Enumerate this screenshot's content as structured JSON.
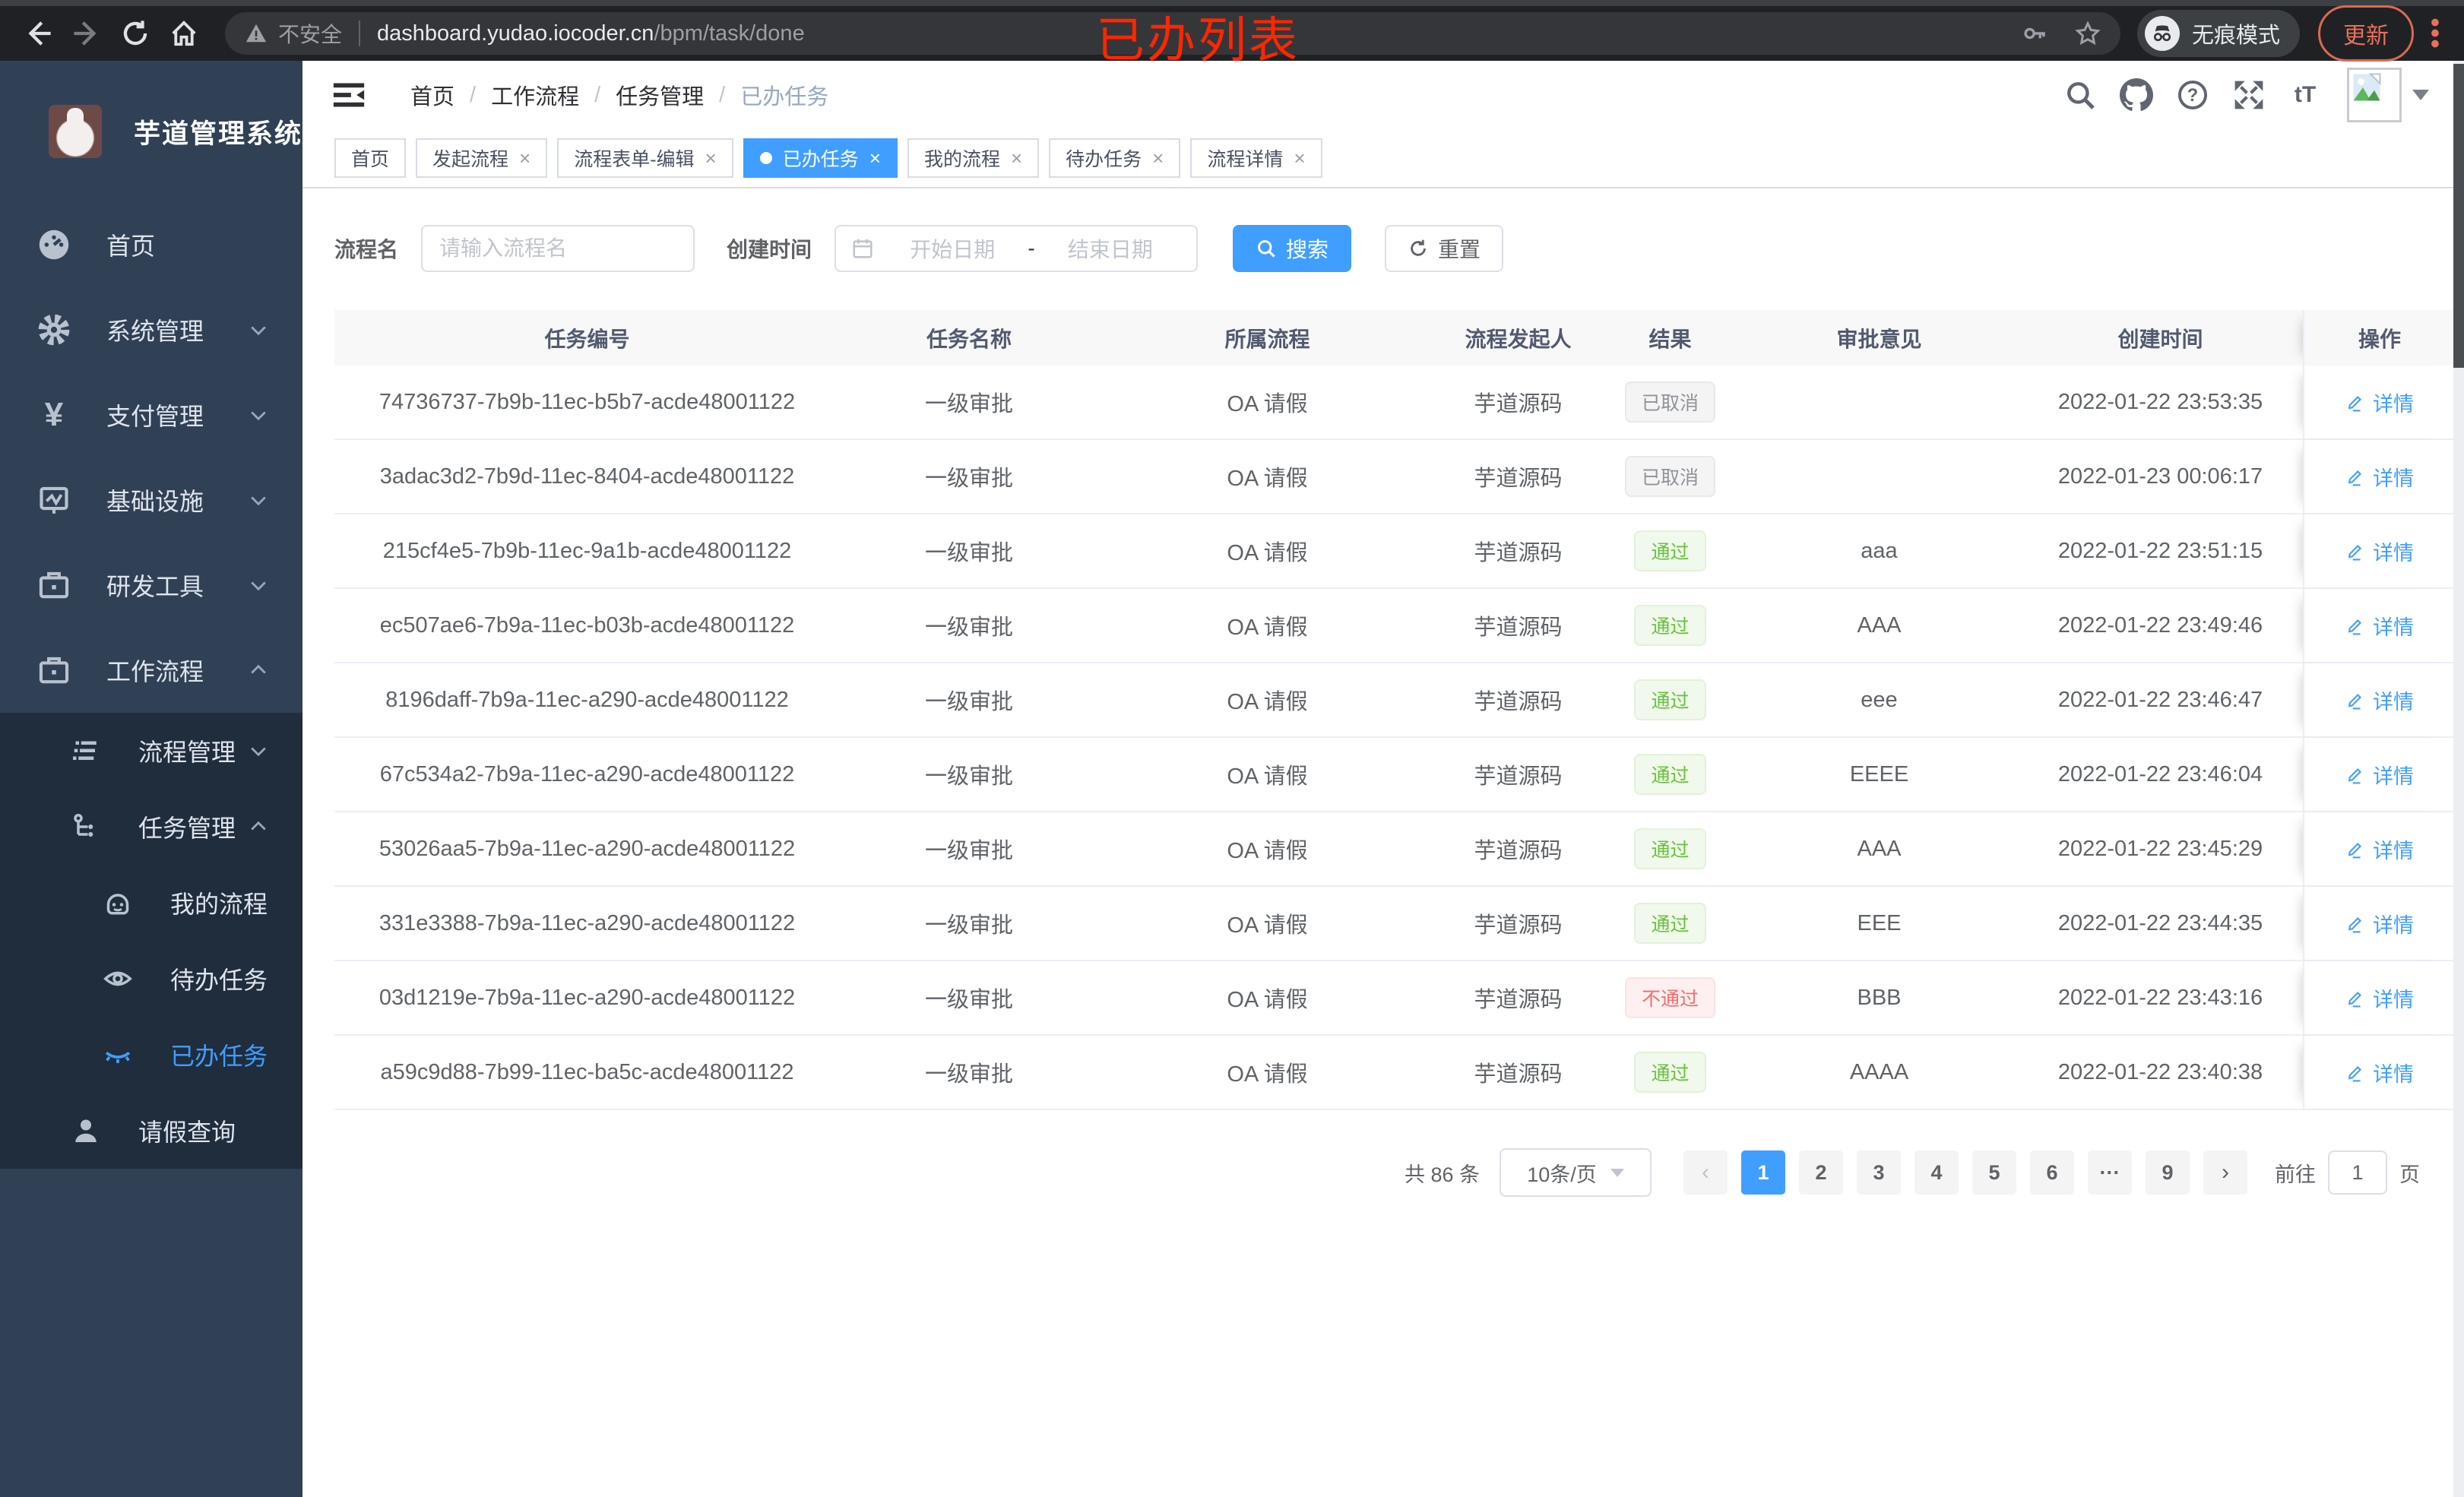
{
  "browser": {
    "not_secure": "不安全",
    "url_host": "dashboard.yudao.iocoder.cn",
    "url_path": "/bpm/task/done",
    "incognito": "无痕模式",
    "update": "更新"
  },
  "annotation": {
    "text": "已办列表",
    "color": "#ff2600"
  },
  "sidebar": {
    "title": "芋道管理系统",
    "menu": [
      {
        "label": "首页",
        "icon": "dashboard-icon"
      },
      {
        "label": "系统管理",
        "icon": "gear-icon"
      },
      {
        "label": "支付管理",
        "icon": "yen-icon"
      },
      {
        "label": "基础设施",
        "icon": "monitor-icon"
      },
      {
        "label": "研发工具",
        "icon": "briefcase-icon"
      },
      {
        "label": "工作流程",
        "icon": "briefcase-icon"
      }
    ],
    "submenu": [
      {
        "label": "流程管理",
        "icon": "list-icon"
      },
      {
        "label": "任务管理",
        "icon": "flow-icon"
      }
    ],
    "children": [
      {
        "label": "我的流程",
        "icon": "face-icon"
      },
      {
        "label": "待办任务",
        "icon": "eye-icon"
      },
      {
        "label": "已办任务",
        "icon": "eye-closed-icon"
      }
    ],
    "leave_query": "请假查询"
  },
  "header": {
    "breadcrumb": [
      "首页",
      "工作流程",
      "任务管理",
      "已办任务"
    ],
    "font_size_icon_text": "tT"
  },
  "tabs": [
    {
      "label": "首页"
    },
    {
      "label": "发起流程"
    },
    {
      "label": "流程表单-编辑"
    },
    {
      "label": "已办任务"
    },
    {
      "label": "我的流程"
    },
    {
      "label": "待办任务"
    },
    {
      "label": "流程详情"
    }
  ],
  "filters": {
    "name_label": "流程名",
    "name_placeholder": "请输入流程名",
    "time_label": "创建时间",
    "start_placeholder": "开始日期",
    "range_separator": "-",
    "end_placeholder": "结束日期",
    "search": "搜索",
    "reset": "重置"
  },
  "table": {
    "columns": [
      "任务编号",
      "任务名称",
      "所属流程",
      "流程发起人",
      "结果",
      "审批意见",
      "创建时间",
      "操作"
    ],
    "action_label": "详情",
    "rows": [
      {
        "id": "74736737-7b9b-11ec-b5b7-acde48001122",
        "name": "一级审批",
        "process": "OA 请假",
        "starter": "芋道源码",
        "result": "已取消",
        "badge_class": "badge info",
        "comment": "",
        "time": "2022-01-22 23:53:35"
      },
      {
        "id": "3adac3d2-7b9d-11ec-8404-acde48001122",
        "name": "一级审批",
        "process": "OA 请假",
        "starter": "芋道源码",
        "result": "已取消",
        "badge_class": "badge info",
        "comment": "",
        "time": "2022-01-23 00:06:17"
      },
      {
        "id": "215cf4e5-7b9b-11ec-9a1b-acde48001122",
        "name": "一级审批",
        "process": "OA 请假",
        "starter": "芋道源码",
        "result": "通过",
        "badge_class": "badge success",
        "comment": "aaa",
        "time": "2022-01-22 23:51:15"
      },
      {
        "id": "ec507ae6-7b9a-11ec-b03b-acde48001122",
        "name": "一级审批",
        "process": "OA 请假",
        "starter": "芋道源码",
        "result": "通过",
        "badge_class": "badge success",
        "comment": "AAA",
        "time": "2022-01-22 23:49:46"
      },
      {
        "id": "8196daff-7b9a-11ec-a290-acde48001122",
        "name": "一级审批",
        "process": "OA 请假",
        "starter": "芋道源码",
        "result": "通过",
        "badge_class": "badge success",
        "comment": "eee",
        "time": "2022-01-22 23:46:47"
      },
      {
        "id": "67c534a2-7b9a-11ec-a290-acde48001122",
        "name": "一级审批",
        "process": "OA 请假",
        "starter": "芋道源码",
        "result": "通过",
        "badge_class": "badge success",
        "comment": "EEEE",
        "time": "2022-01-22 23:46:04"
      },
      {
        "id": "53026aa5-7b9a-11ec-a290-acde48001122",
        "name": "一级审批",
        "process": "OA 请假",
        "starter": "芋道源码",
        "result": "通过",
        "badge_class": "badge success",
        "comment": "AAA",
        "time": "2022-01-22 23:45:29"
      },
      {
        "id": "331e3388-7b9a-11ec-a290-acde48001122",
        "name": "一级审批",
        "process": "OA 请假",
        "starter": "芋道源码",
        "result": "通过",
        "badge_class": "badge success",
        "comment": "EEE",
        "time": "2022-01-22 23:44:35"
      },
      {
        "id": "03d1219e-7b9a-11ec-a290-acde48001122",
        "name": "一级审批",
        "process": "OA 请假",
        "starter": "芋道源码",
        "result": "不通过",
        "badge_class": "badge danger",
        "comment": "BBB",
        "time": "2022-01-22 23:43:16"
      },
      {
        "id": "a59c9d88-7b99-11ec-ba5c-acde48001122",
        "name": "一级审批",
        "process": "OA 请假",
        "starter": "芋道源码",
        "result": "通过",
        "badge_class": "badge success",
        "comment": "AAAA",
        "time": "2022-01-22 23:40:38"
      }
    ]
  },
  "pagination": {
    "total": "共 86 条",
    "page_size": "10条/页",
    "pages": [
      "1",
      "2",
      "3",
      "4",
      "5",
      "6",
      "···",
      "9"
    ],
    "goto_label": "前往",
    "goto_value": "1",
    "goto_suffix": "页"
  },
  "colors": {
    "accent": "#409eff",
    "success": "#67c23a",
    "danger": "#f56c6c",
    "sidebar": "#304156",
    "sidebar_dark": "#1f2d3d"
  }
}
